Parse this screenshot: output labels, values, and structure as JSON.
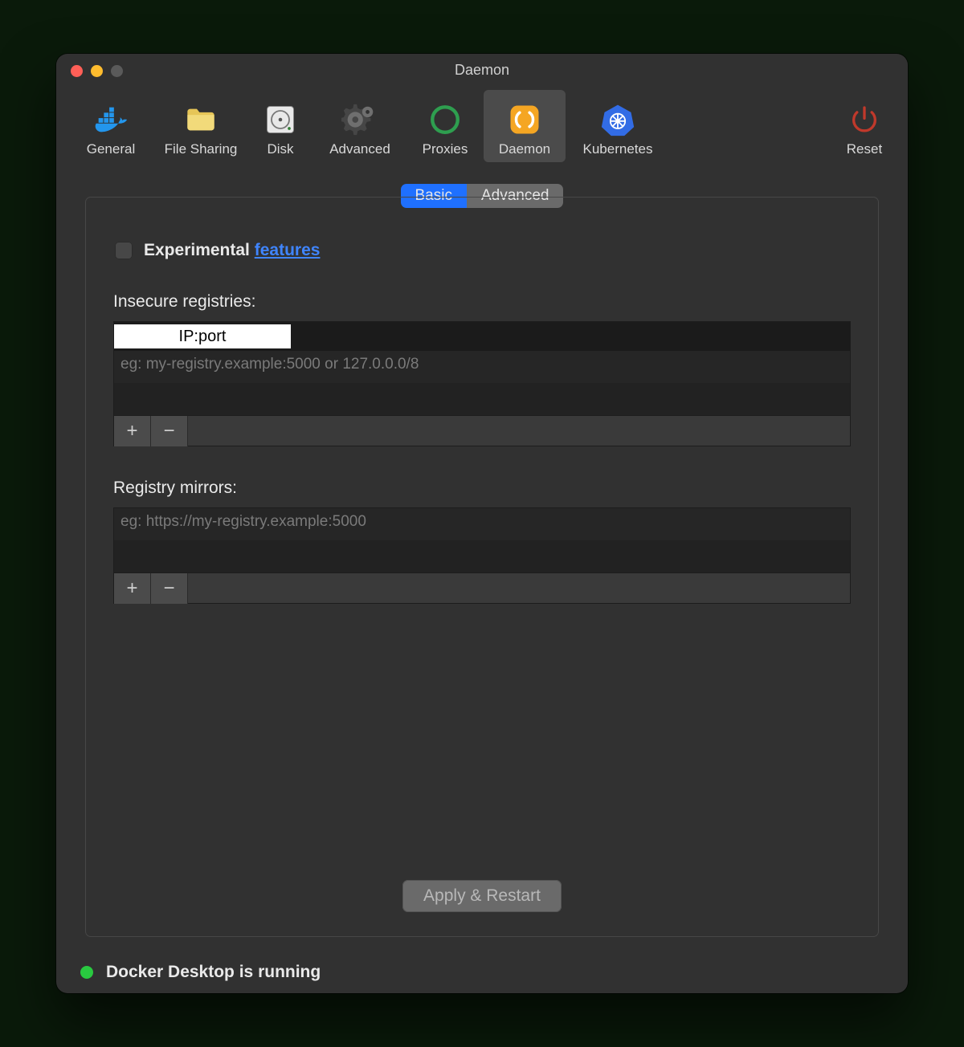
{
  "window": {
    "title": "Daemon"
  },
  "toolbar": {
    "items": [
      {
        "label": "General"
      },
      {
        "label": "File Sharing"
      },
      {
        "label": "Disk"
      },
      {
        "label": "Advanced"
      },
      {
        "label": "Proxies"
      },
      {
        "label": "Daemon"
      },
      {
        "label": "Kubernetes"
      }
    ],
    "reset": "Reset"
  },
  "segmented": {
    "basic": "Basic",
    "advanced": "Advanced",
    "active": "Basic"
  },
  "experimental": {
    "prefix": "Experimental ",
    "link": "features",
    "checked": false
  },
  "insecure": {
    "label": "Insecure registries:",
    "value": "IP:port",
    "hint": "eg: my-registry.example:5000 or 127.0.0.0/8"
  },
  "mirrors": {
    "label": "Registry mirrors:",
    "hint": "eg: https://my-registry.example:5000"
  },
  "buttons": {
    "add": "+",
    "remove": "−",
    "apply": "Apply & Restart"
  },
  "status": {
    "text": "Docker Desktop is running",
    "color": "#29c940"
  }
}
